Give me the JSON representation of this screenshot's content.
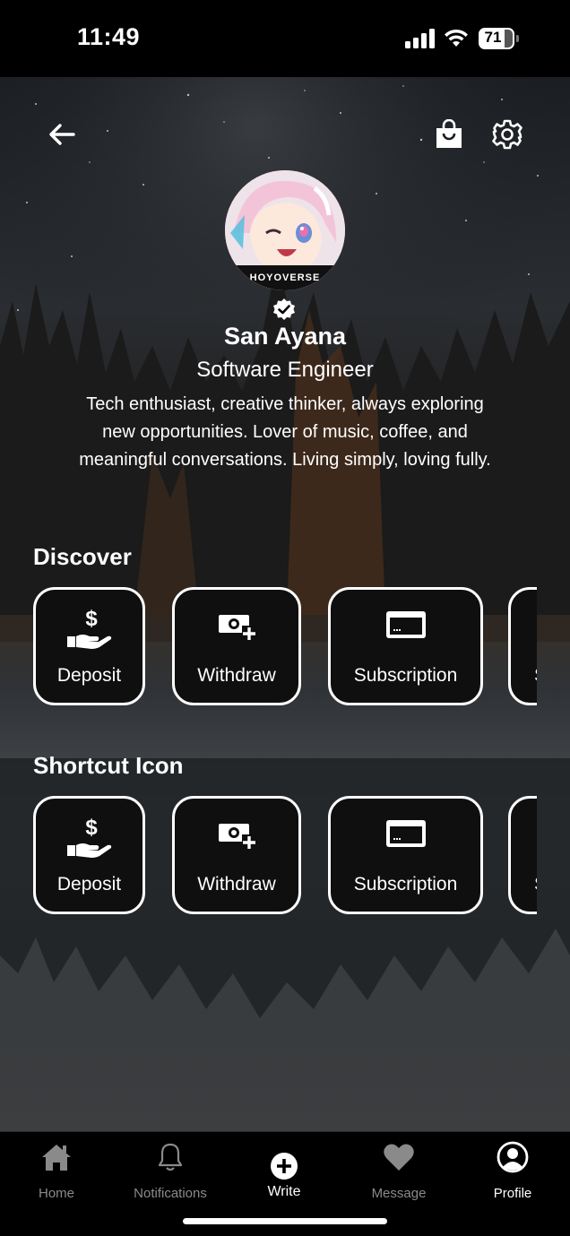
{
  "status_bar": {
    "time": "11:49",
    "battery": "71"
  },
  "profile": {
    "name": "San Ayana",
    "role": "Software Engineer",
    "bio": "Tech enthusiast, creative thinker, always exploring new opportunities. Lover of music, coffee, and meaningful conversations. Living simply, loving fully.",
    "avatar_caption": "HOYOVERSE"
  },
  "sections": [
    {
      "title": "Discover",
      "items": [
        {
          "label": "Deposit",
          "icon": "hand-dollar-icon"
        },
        {
          "label": "Withdraw",
          "icon": "money-plus-icon"
        },
        {
          "label": "Subscription",
          "icon": "credit-card-icon"
        },
        {
          "label": "S",
          "icon": "partial-card"
        }
      ]
    },
    {
      "title": "Shortcut Icon",
      "items": [
        {
          "label": "Deposit",
          "icon": "hand-dollar-icon"
        },
        {
          "label": "Withdraw",
          "icon": "money-plus-icon"
        },
        {
          "label": "Subscription",
          "icon": "credit-card-icon"
        },
        {
          "label": "S",
          "icon": "partial-card"
        }
      ]
    }
  ],
  "tabs": [
    {
      "label": "Home",
      "icon": "home-icon",
      "active": false
    },
    {
      "label": "Notifications",
      "icon": "bell-icon",
      "active": false
    },
    {
      "label": "Write",
      "icon": "plus-circle-icon",
      "active": true
    },
    {
      "label": "Message",
      "icon": "heart-icon",
      "active": false
    },
    {
      "label": "Profile",
      "icon": "user-circle-icon",
      "active": true
    }
  ],
  "colors": {
    "background": "#000000",
    "card": "#0f0f0f",
    "text": "#ffffff",
    "inactive_tab": "#8a8a8a"
  }
}
